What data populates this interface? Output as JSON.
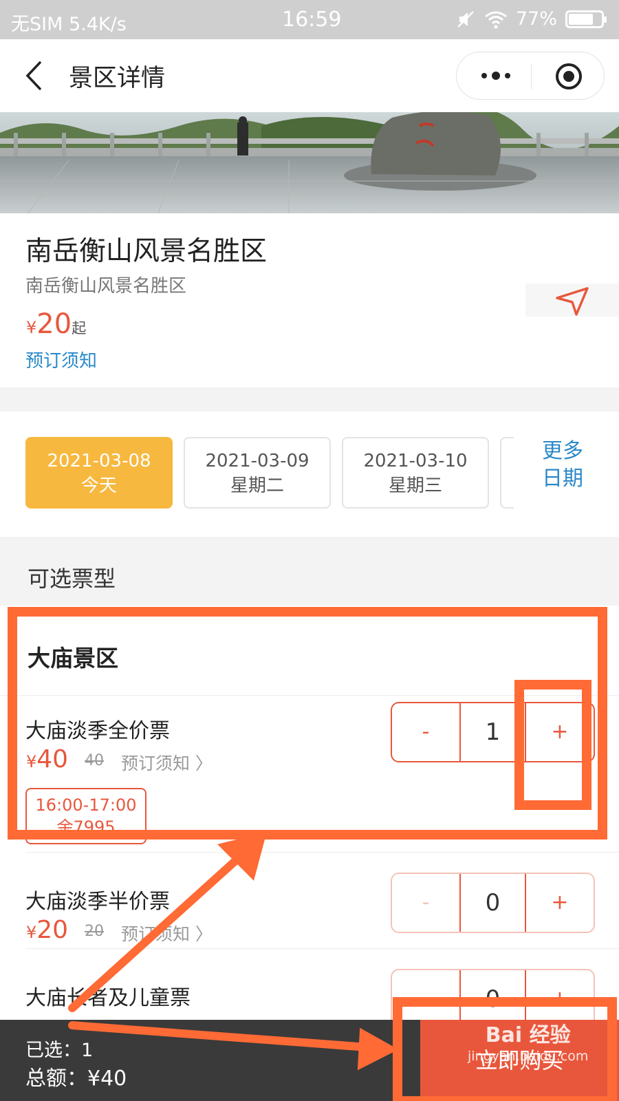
{
  "status_bar": {
    "left": "无SIM 5.4K/s",
    "time": "16:59",
    "battery": "77%",
    "battery_level": 0.77
  },
  "navbar": {
    "title": "景区详情"
  },
  "scenic": {
    "name": "南岳衡山风景名胜区",
    "subname": "南岳衡山风景名胜区",
    "price_symbol": "¥",
    "price": "20",
    "price_suffix": "起",
    "notice": "预订须知"
  },
  "dates": {
    "items": [
      {
        "date": "2021-03-08",
        "day": "今天",
        "active": true
      },
      {
        "date": "2021-03-09",
        "day": "星期二",
        "active": false
      },
      {
        "date": "2021-03-10",
        "day": "星期三",
        "active": false
      }
    ],
    "more_line1": "更多",
    "more_line2": "日期"
  },
  "tickets": {
    "section_label": "可选票型",
    "group_title": "大庙景区",
    "items": [
      {
        "name": "大庙淡季全价票",
        "price": "40",
        "orig": "40",
        "notice": "预订须知",
        "qty": "1",
        "slot_time": "16:00-17:00",
        "slot_remain": "余7995"
      },
      {
        "name": "大庙淡季半价票",
        "price": "20",
        "orig": "20",
        "notice": "预订须知",
        "qty": "0"
      },
      {
        "name": "大庙长者及儿童票",
        "qty": "0"
      }
    ],
    "minus": "-",
    "plus": "+",
    "currency": "¥",
    "chevron": "〉"
  },
  "bottom_bar": {
    "selected": "已选：1",
    "total": "总额：¥40",
    "buy_button": "立即购买"
  },
  "watermark": {
    "line1": "Bai 经验",
    "line2": "jingyan.baidu.com"
  },
  "colors": {
    "accent": "#e8573c",
    "date_active": "#f7b83f",
    "link": "#2a89c9",
    "annotation": "#ff6a35"
  }
}
